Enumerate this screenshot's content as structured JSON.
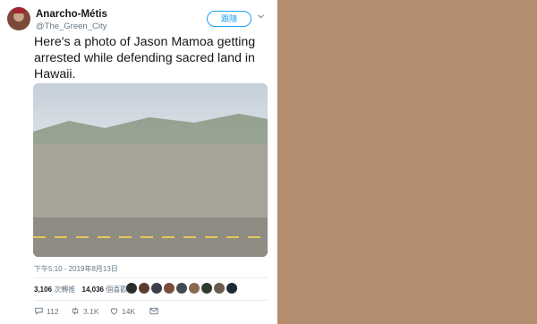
{
  "tweet": {
    "display_name": "Anarcho-Métis",
    "handle": "@The_Green_City",
    "follow_label": "跟隨",
    "text": "Here's a photo of Jason Mamoa getting arrested while defending sacred land in Hawaii.",
    "timestamp": "下午5:10 - 2019年8月13日",
    "retweets_count": "3,106",
    "retweets_label": "次轉推",
    "likes_count": "14,036",
    "likes_label": "個喜歡",
    "replies": "112",
    "retweets_short": "3.1K",
    "likes_short": "14K"
  },
  "colors": {
    "accent": "#1da1f2",
    "text": "#14171a",
    "muted": "#657786"
  },
  "icons": {
    "reply": "reply-icon",
    "retweet": "retweet-icon",
    "like": "heart-icon",
    "message": "envelope-icon"
  }
}
